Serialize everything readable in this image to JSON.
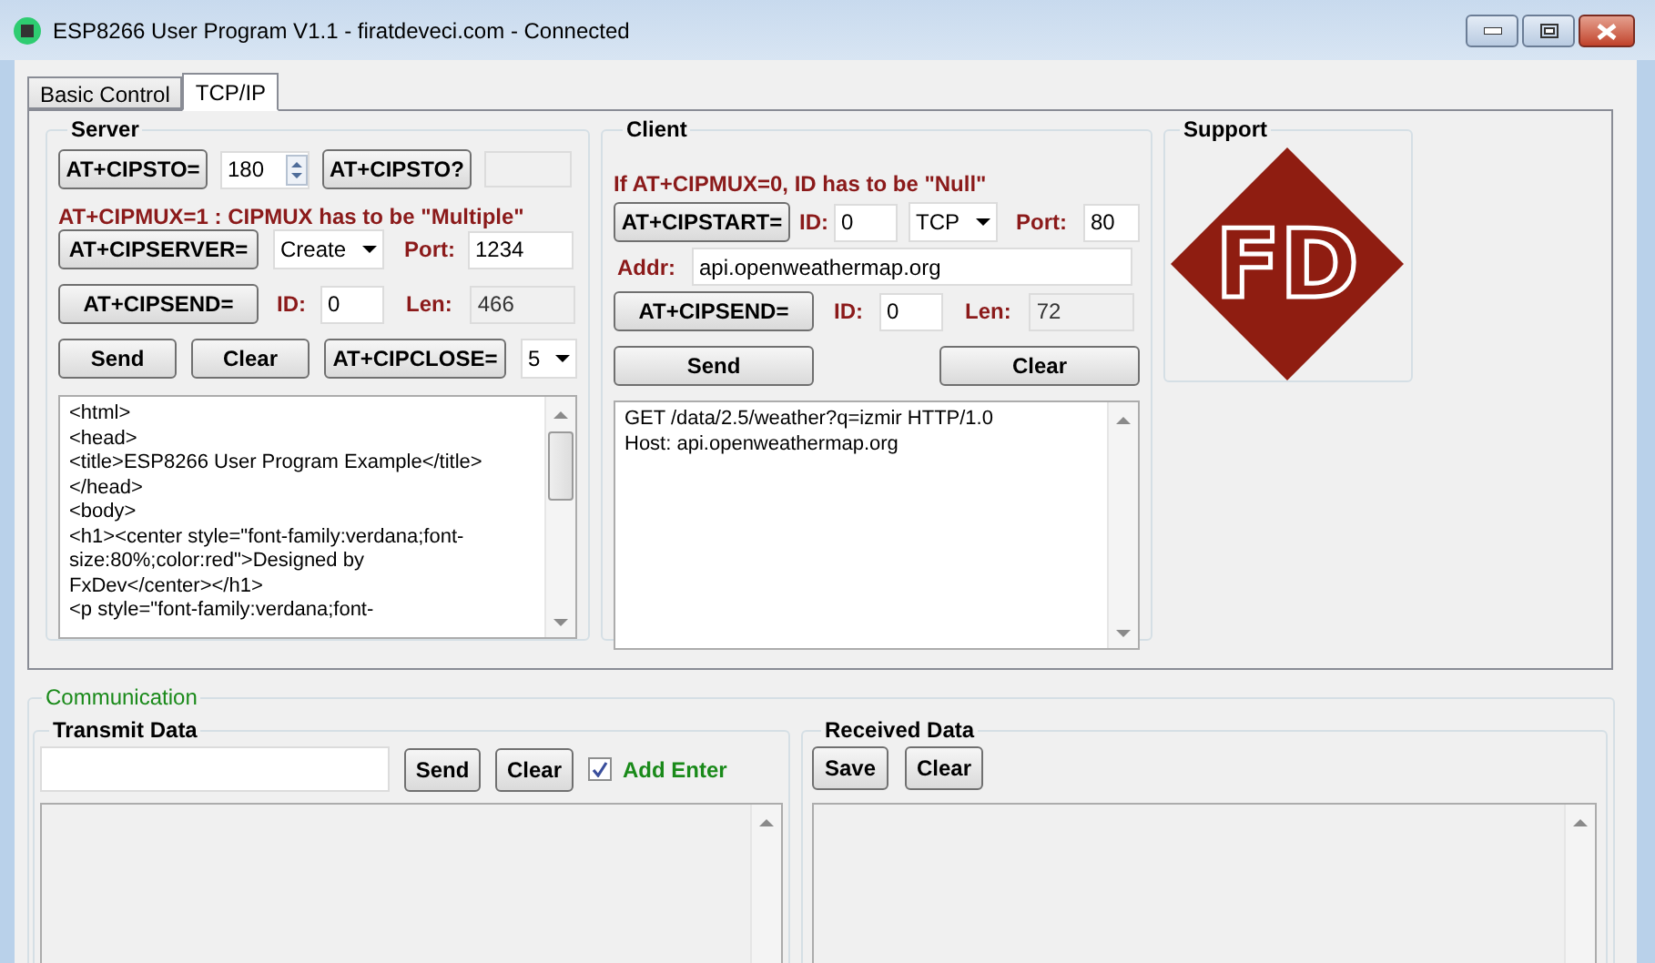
{
  "window": {
    "title": "ESP8266 User Program V1.1 - firatdeveci.com - Connected"
  },
  "tabs": [
    {
      "label": "Basic Control",
      "selected": false
    },
    {
      "label": "TCP/IP",
      "selected": true
    }
  ],
  "server": {
    "title": "Server",
    "cipsto_button": "AT+CIPSTO=",
    "timeout": "180",
    "cipsto_query_button": "AT+CIPSTO?",
    "note": "AT+CIPMUX=1 : CIPMUX has to be \"Multiple\"",
    "cipserver_button": "AT+CIPSERVER=",
    "mode": "Create",
    "port_label": "Port:",
    "port": "1234",
    "cipsend_button": "AT+CIPSEND=",
    "id_label": "ID:",
    "id": "0",
    "len_label": "Len:",
    "len": "466",
    "send_button": "Send",
    "clear_button": "Clear",
    "cipclose_button": "AT+CIPCLOSE=",
    "close_id": "5",
    "text_lines": [
      "<html>",
      "<head>",
      "<title>ESP8266 User Program Example</title>",
      "</head>",
      "<body>",
      "<h1><center style=\"font-family:verdana;font-",
      "size:80%;color:red\">Designed by",
      "FxDev</center></h1>",
      "<p style=\"font-family:verdana;font-"
    ]
  },
  "client": {
    "title": "Client",
    "note": "If AT+CIPMUX=0, ID has to be \"Null\"",
    "cipstart_button": "AT+CIPSTART=",
    "id_label": "ID:",
    "id": "0",
    "protocol": "TCP",
    "port_label": "Port:",
    "port": "80",
    "addr_label": "Addr:",
    "addr": "api.openweathermap.org",
    "cipsend_button": "AT+CIPSEND=",
    "send_id_label": "ID:",
    "send_id": "0",
    "len_label": "Len:",
    "len": "72",
    "send_button": "Send",
    "clear_button": "Clear",
    "text_lines": [
      "GET /data/2.5/weather?q=izmir HTTP/1.0",
      "Host: api.openweathermap.org"
    ]
  },
  "support": {
    "title": "Support",
    "logo_text": "FD"
  },
  "communication": {
    "title": "Communication",
    "transmit": {
      "title": "Transmit Data",
      "send_button": "Send",
      "clear_button": "Clear",
      "add_enter": {
        "label": "Add Enter",
        "checked": true
      }
    },
    "received": {
      "title": "Received Data",
      "save_button": "Save",
      "clear_button": "Clear"
    }
  }
}
